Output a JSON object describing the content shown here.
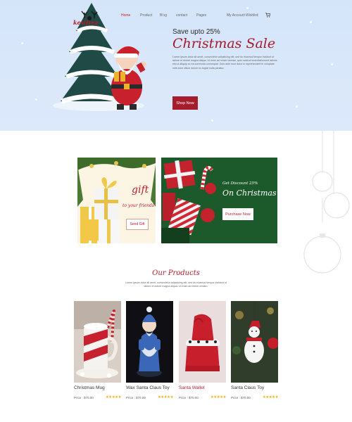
{
  "brand": {
    "name": "kesifree",
    "logo_icon": "reindeer-antlers-icon"
  },
  "nav": {
    "items": [
      "Home",
      "Product",
      "Blog",
      "contact",
      "Pages"
    ],
    "active": "Home",
    "account": "My Account",
    "wishlist": "Wishlist",
    "cart_icon": "cart-icon"
  },
  "hero": {
    "subtitle": "Save upto 25%",
    "title": "Christmas Sale",
    "description": "Lorem ipsum dolor sit amet, consectetur adipisicing elit, sed do eiusmod tempor incidunt ut labore et dolore magna aliqua. Ut enim ad minim veniam, quis nostrud exercitationmnt laboris nisi ut aliquip ex ea commodo consequat. Duis aute irure dolor in reprehenderit in voluptate velit esse cillum dolore eu fugiat nulla pariatur.",
    "button": "Shop Now"
  },
  "promo_gift": {
    "title": "gift",
    "subtitle": "to your friends",
    "button": "Send Gift"
  },
  "promo_sale": {
    "eyebrow": "Get Discount 25%",
    "title": "On Christmas Sale",
    "button": "Purchase Now"
  },
  "products_section": {
    "heading": "Our Products",
    "description": "Lorem ipsum dolor sit amet, consectetur adipisicing elit, sed do eiusmod tempor incidunt ut labore et dolore magna aliqua. Ut enim ad minim veniam.",
    "items": [
      {
        "name": "Christmas Mug",
        "price": "Price : $70.00",
        "stars": "★★★★★",
        "highlight": false
      },
      {
        "name": "Wax Santa Claus Toy",
        "price": "Price : $70.00",
        "stars": "★★★★★",
        "highlight": false
      },
      {
        "name": "Santa Wallet",
        "price": "Price : $70.00",
        "stars": "★★★★★",
        "highlight": true
      },
      {
        "name": "Santa Claus Toy",
        "price": "Price : $70.00",
        "stars": "★★★★★",
        "highlight": false
      }
    ]
  },
  "colors": {
    "accent": "#a51c2c",
    "hero_bg": "#d9e7fa",
    "promo_green": "#1b5429",
    "star": "#f2b01e"
  }
}
